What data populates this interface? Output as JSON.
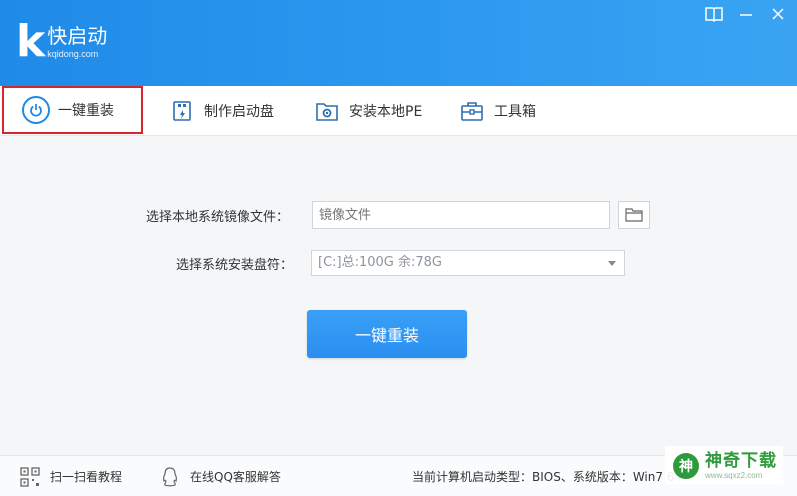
{
  "app": {
    "logo_letter": "k",
    "name": "快启动",
    "domain": "kqidong.com"
  },
  "tabs": [
    {
      "label": "一键重装",
      "icon": "power-icon",
      "active": true
    },
    {
      "label": "制作启动盘",
      "icon": "usb-drive-icon",
      "active": false
    },
    {
      "label": "安装本地PE",
      "icon": "gear-icon",
      "active": false
    },
    {
      "label": "工具箱",
      "icon": "toolbox-icon",
      "active": false
    }
  ],
  "form": {
    "image_label": "选择本地系统镜像文件：",
    "image_placeholder": "镜像文件",
    "drive_label": "选择系统安装盘符：",
    "drive_selected": "[C:]总:100G 余:78G",
    "submit_label": "一键重装"
  },
  "footer": {
    "scan_label": "扫一扫看教程",
    "qq_label": "在线QQ客服解答",
    "status_text": "当前计算机启动类型：BIOS、系统版本：Win7 64"
  },
  "watermark": {
    "logo_char": "神",
    "name": "神奇下载",
    "url": "www.sqxz2.com"
  },
  "colors": {
    "header": "#2b97ee",
    "accent": "#2a8ff0",
    "active_tab_border": "#d5262c"
  }
}
